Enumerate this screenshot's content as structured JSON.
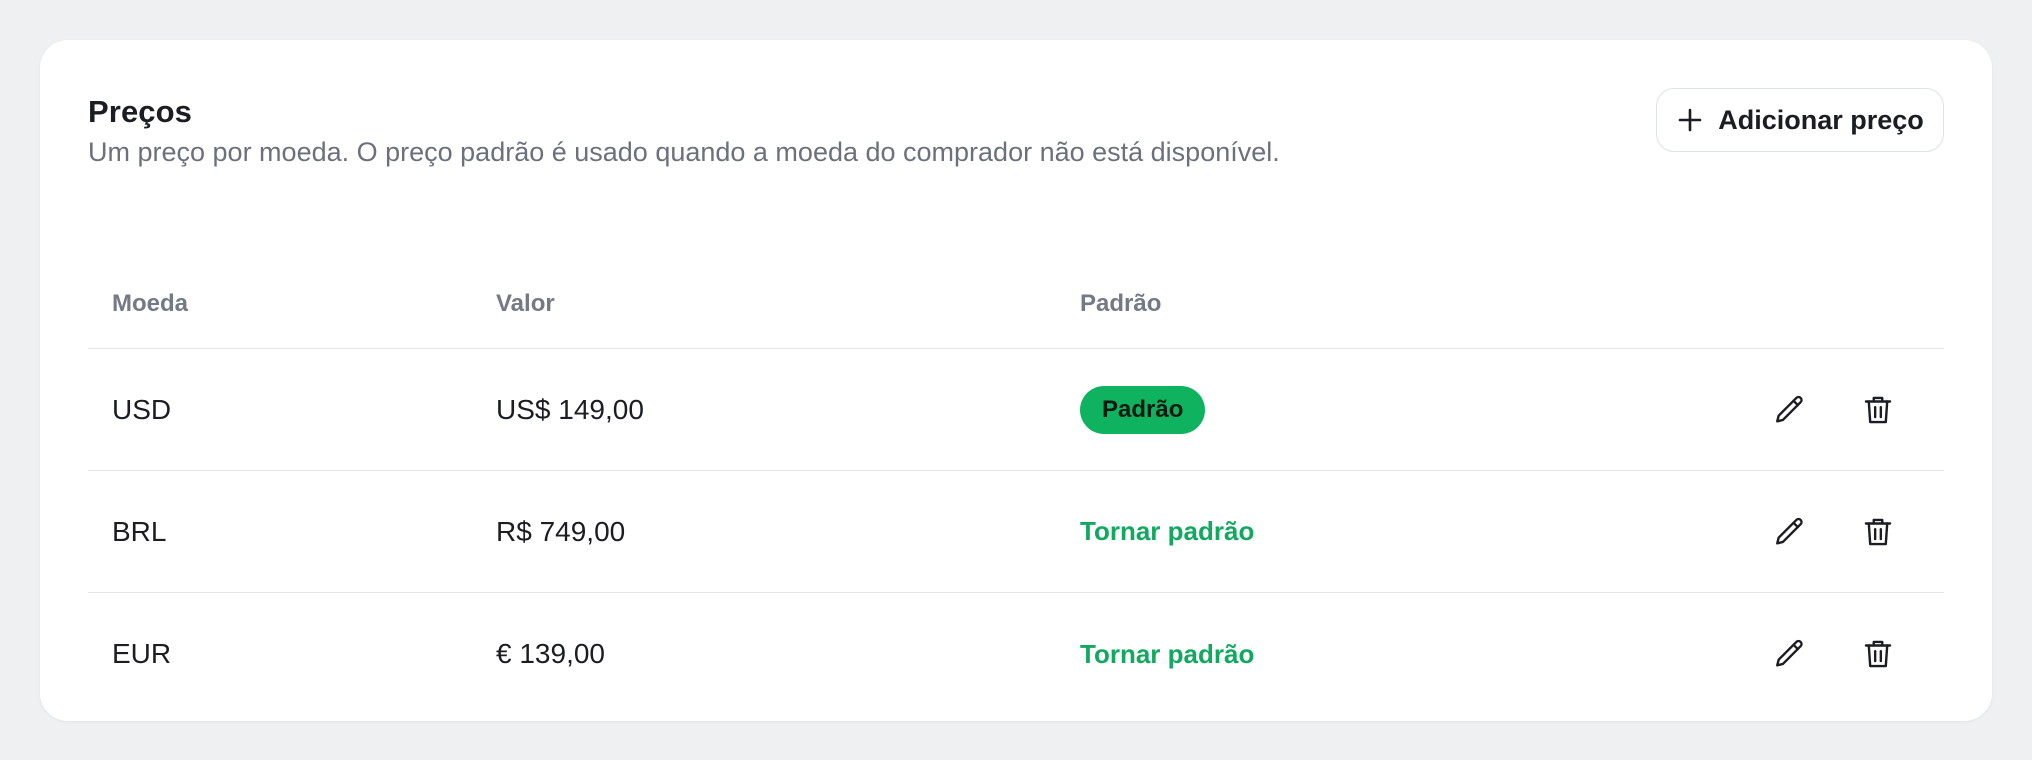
{
  "card": {
    "title": "Preços",
    "subtitle": "Um preço por moeda. O preço padrão é usado quando a moeda do comprador não está disponível.",
    "add_button_label": "Adicionar preço",
    "add_button_icon": "plus-icon"
  },
  "table": {
    "headers": [
      "Moeda",
      "Valor",
      "Padrão"
    ],
    "rows": [
      {
        "currency": "USD",
        "amount": "US$ 149,00",
        "is_default": true,
        "default_label": "Padrão"
      },
      {
        "currency": "BRL",
        "amount": "R$ 749,00",
        "is_default": false,
        "default_label": "Tornar padrão"
      },
      {
        "currency": "EUR",
        "amount": "€ 139,00",
        "is_default": false,
        "default_label": "Tornar padrão"
      }
    ],
    "row_actions": [
      "edit-pencil-icon",
      "delete-trash-icon"
    ]
  },
  "colors": {
    "accent_green": "#0fb35f",
    "link_green": "#12a860",
    "muted_text": "#6b717c",
    "background": "#eff0f2"
  }
}
